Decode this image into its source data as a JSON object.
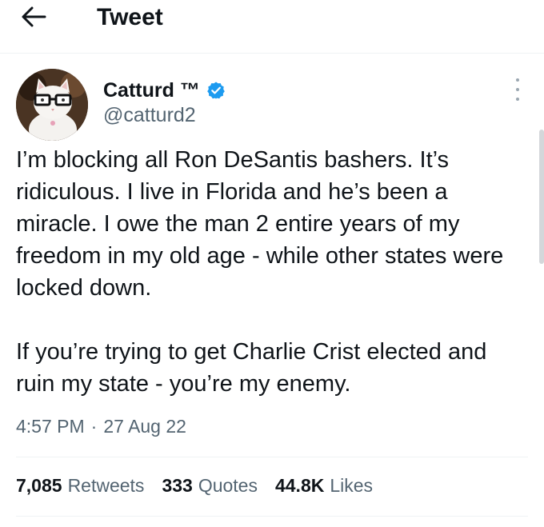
{
  "header": {
    "back_icon": "arrow-left-icon",
    "title": "Tweet"
  },
  "author": {
    "name": "Catturd ™",
    "verified_icon": "verified-badge-icon",
    "verified_color": "#1d9bf0",
    "handle": "@catturd2"
  },
  "tweet": {
    "paragraphs": [
      "I’m blocking all Ron DeSantis bashers. It’s ridiculous. I live in Florida and he’s been a miracle. I owe the man 2 entire years of my freedom in my old age - while other states were locked down.",
      "If you’re trying to get Charlie Crist elected and ruin my state - you’re my enemy."
    ],
    "time": "4:57 PM",
    "separator": "·",
    "date": "27 Aug 22"
  },
  "stats": {
    "retweets": {
      "count": "7,085",
      "label": "Retweets"
    },
    "quotes": {
      "count": "333",
      "label": "Quotes"
    },
    "likes": {
      "count": "44.8K",
      "label": "Likes"
    }
  },
  "colors": {
    "text_primary": "#0f1419",
    "text_secondary": "#536471",
    "divider": "#eff3f4"
  }
}
